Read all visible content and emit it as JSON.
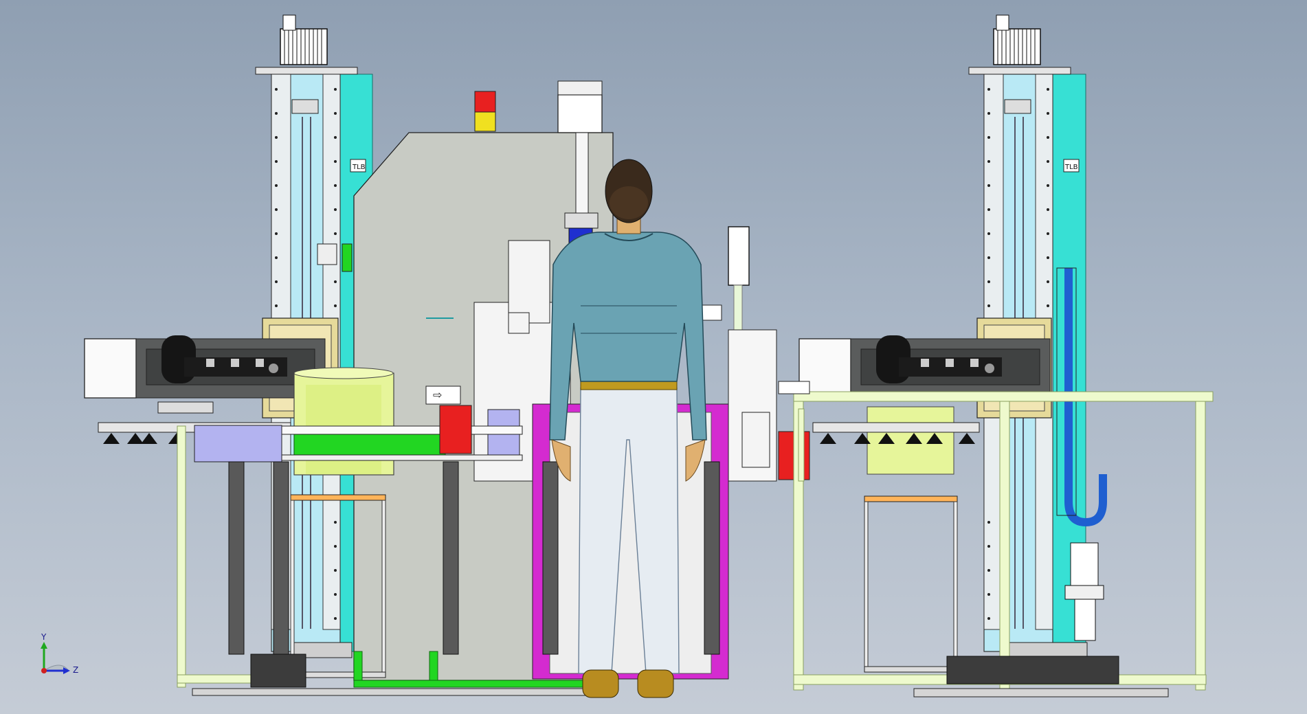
{
  "app": {
    "viewport_background": [
      "#8f9fb2",
      "#c5ccd6"
    ]
  },
  "triad": {
    "x_label": "",
    "y_label": "Y",
    "z_label": "Z"
  },
  "colors": {
    "cyan_panel": "#37e0d4",
    "light_blue": "#b9e9f5",
    "grey_body": "#c8cbc4",
    "dark_grey": "#5a5c5c",
    "lime": "#e6f59a",
    "green": "#22d622",
    "frame_green": "#eefacd",
    "lavender": "#b3b3f0",
    "magenta": "#d42bd0",
    "red": "#e82020",
    "yellow": "#f0e020",
    "blue_pipe": "#1f5fd0",
    "jacket": "#6aa3b3",
    "pants": "#e6ecf2",
    "belt": "#c09a20",
    "hair": "#3a2a1c",
    "skin": "#e0b070"
  },
  "icons": [
    "coordinate-triad-icon",
    "servo-motor-icon",
    "signal-tower-icon",
    "cable-chain-icon"
  ]
}
